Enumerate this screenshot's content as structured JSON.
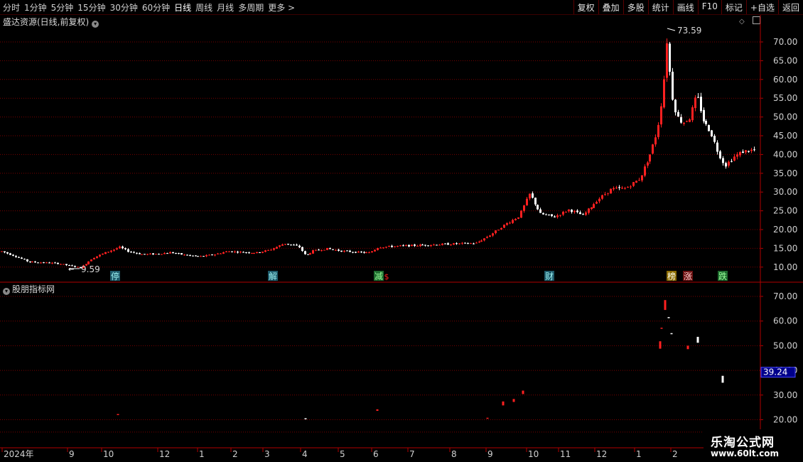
{
  "toolbar": {
    "periods": [
      "分时",
      "1分钟",
      "5分钟",
      "15分钟",
      "30分钟",
      "60分钟",
      "日线",
      "周线",
      "月线",
      "多周期",
      "更多 >"
    ],
    "active_period": "日线",
    "right_buttons": [
      "复权",
      "叠加",
      "多股",
      "统计",
      "画线",
      "F10",
      "标记",
      "+自选",
      "返回"
    ]
  },
  "main_panel": {
    "title": "盛达资源(日线,前复权)",
    "max_label": "73.59",
    "min_label": "9.59",
    "price_axis": [
      "70.00",
      "65.00",
      "60.00",
      "55.00",
      "50.00",
      "45.00",
      "40.00",
      "35.00",
      "30.00",
      "25.00",
      "20.00",
      "15.00",
      "10.00"
    ],
    "events": [
      "停",
      "解",
      "减",
      "$",
      "财",
      "榜",
      "涨",
      "跌"
    ]
  },
  "sub_panel": {
    "title": "股朋指标网",
    "axis": [
      "70.00",
      "60.00",
      "50.00",
      "40.00",
      "30.00",
      "20.00"
    ],
    "current_value": "39.24"
  },
  "time_axis": [
    "2024年",
    "9",
    "10",
    "12",
    "1",
    "2",
    "3",
    "4",
    "5",
    "6",
    "7",
    "8",
    "9",
    "10",
    "11",
    "12",
    "1",
    "2"
  ],
  "watermark": {
    "name": "乐淘公式网",
    "url": "www.60lt.com"
  },
  "colors": {
    "up": "#ff2020",
    "down_fill": "#33cccc",
    "grid": "#7a0000",
    "axis_line": "#b00000",
    "tag_bg": "#1e5a6a"
  }
}
